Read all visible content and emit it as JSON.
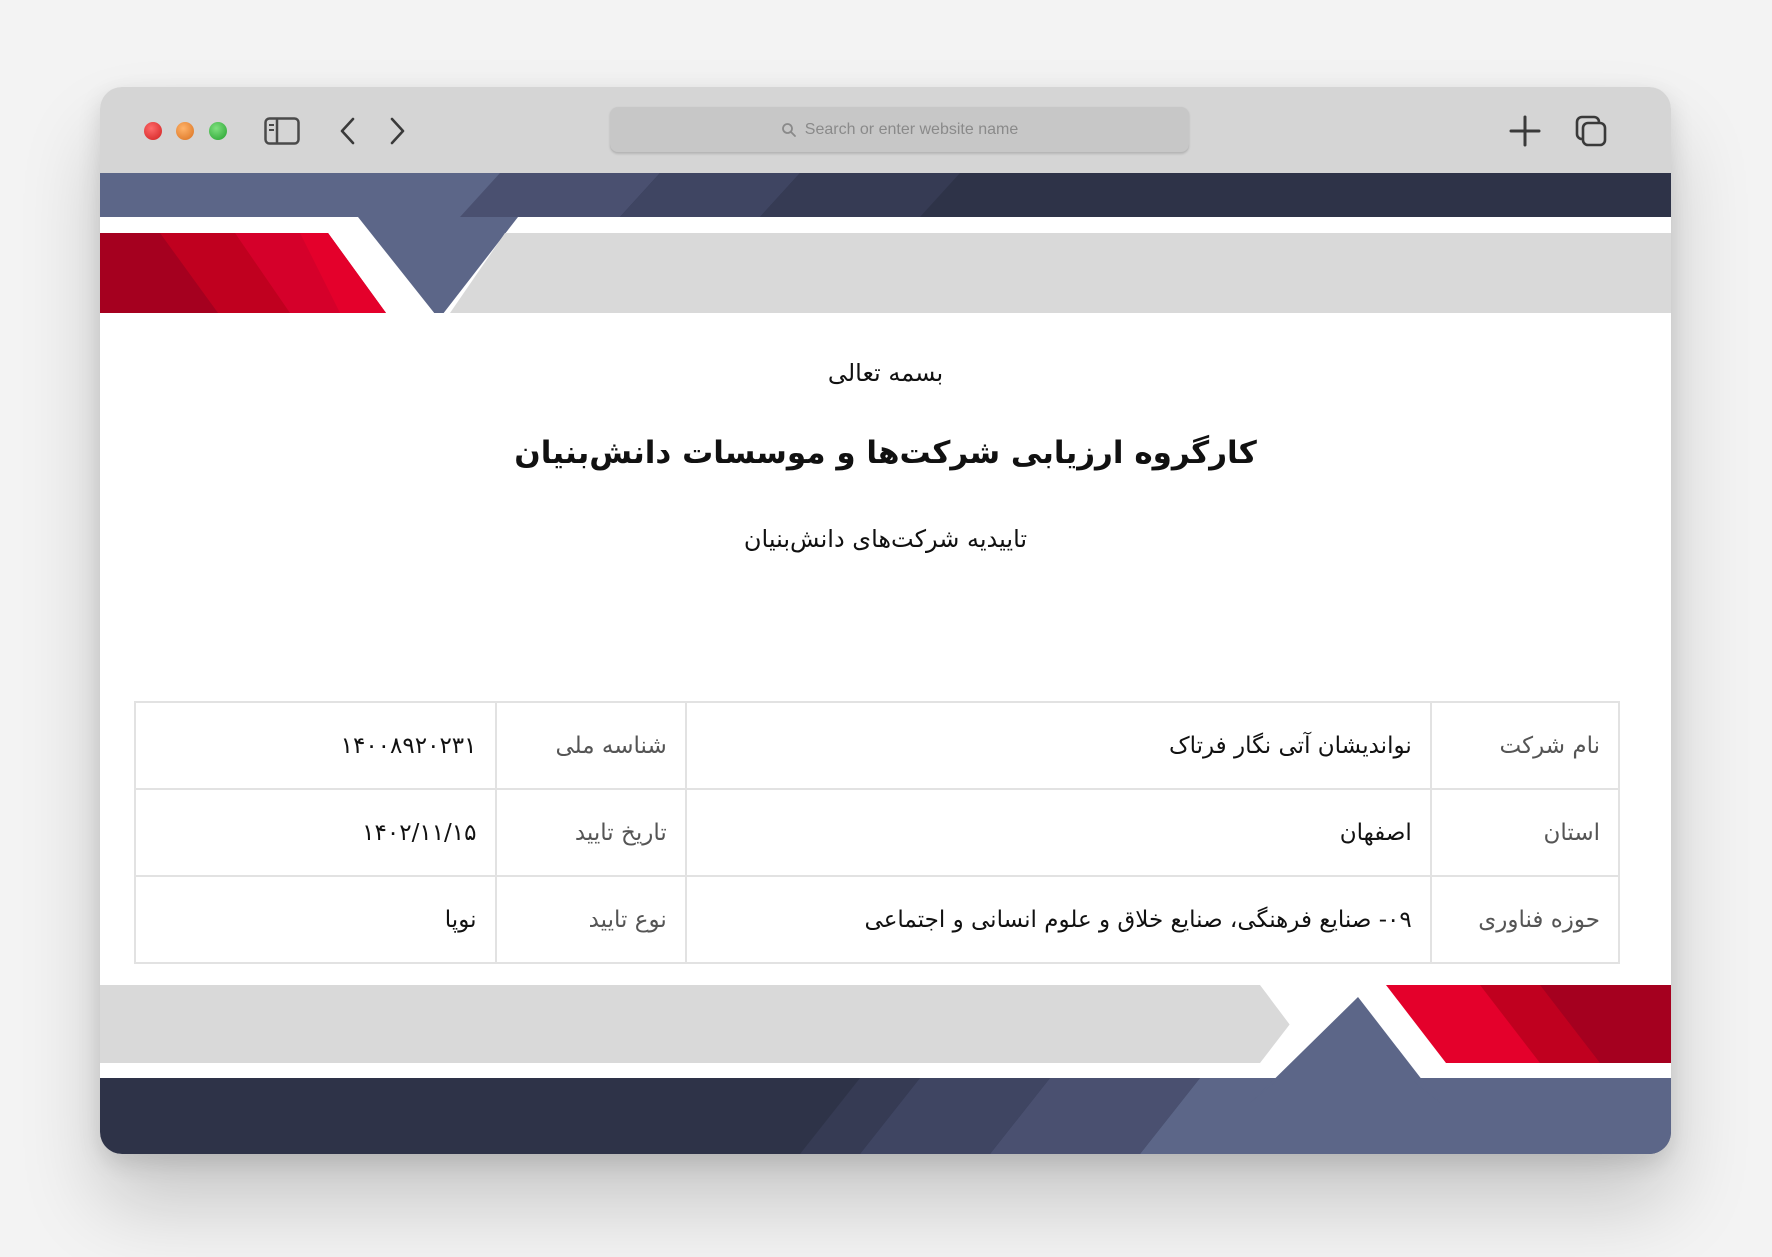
{
  "browser": {
    "address_placeholder": "Search or enter website name",
    "icons": {
      "traffic_lights": [
        "close-dot",
        "minimize-dot",
        "zoom-dot"
      ],
      "sidebar": "sidebar-icon",
      "back": "chevron-left-icon",
      "forward": "chevron-right-icon",
      "search": "search-icon",
      "new_tab": "plus-icon",
      "tabs": "tabs-overview-icon"
    }
  },
  "document": {
    "invocation": "بسمه تعالی",
    "title": "کارگروه ارزیابی شرکت‌ها و موسسات دانش‌بنیان",
    "subtitle": "تاییدیه شرکت‌های دانش‌بنیان",
    "rows": [
      {
        "label_a": "نام شرکت",
        "value_a": "نواندیشان آتی نگار فرتاک",
        "label_b": "شناسه ملی",
        "value_b": "۱۴۰۰۸۹۲۰۲۳۱"
      },
      {
        "label_a": "استان",
        "value_a": "اصفهان",
        "label_b": "تاریخ تایید",
        "value_b": "۱۴۰۲/۱۱/۱۵"
      },
      {
        "label_a": "حوزه فناوری",
        "value_a": "۰۹- صنایع فرهنگی، صنایع خلاق و علوم انسانی و اجتماعی",
        "label_b": "نوع تایید",
        "value_b": "نوپا"
      }
    ]
  },
  "colors": {
    "navy_dark": "#2e3348",
    "navy_mid": "#4a5070",
    "slate": "#5c6688",
    "red": "#e4002b",
    "red_dark": "#a5001f",
    "gray_band": "#d9d9d9"
  }
}
